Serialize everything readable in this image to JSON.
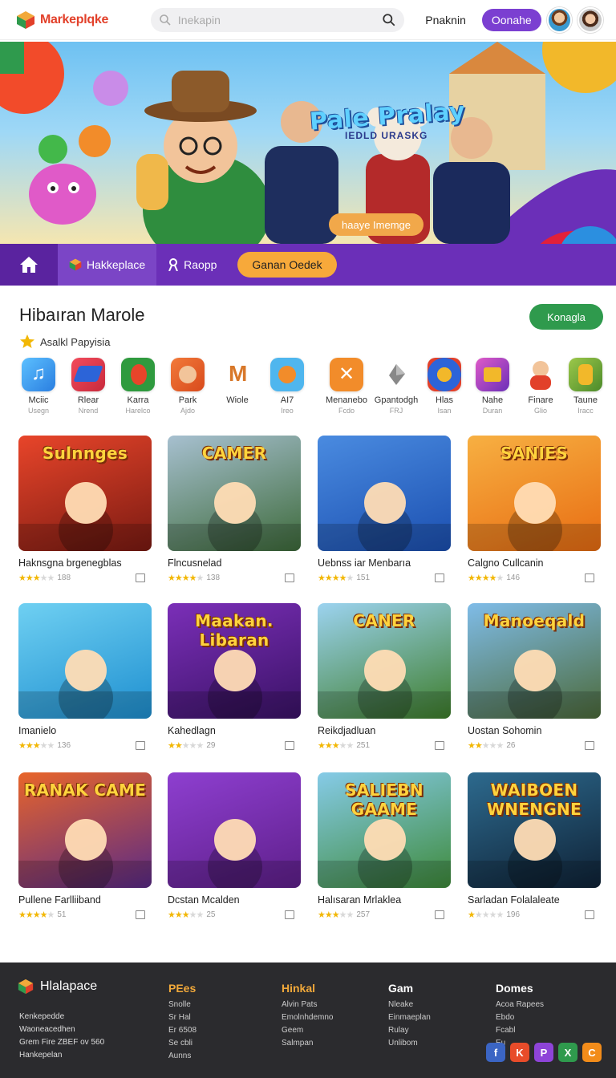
{
  "header": {
    "brand": "Markeplqke",
    "search_placeholder": "Inekapin",
    "nav_link": "Pnaknin",
    "cta": "Oonahe"
  },
  "hero": {
    "title": "Pale Pralay",
    "subtitle": "IEDLD URASKG",
    "pill": "haaye Imemge"
  },
  "catbar": {
    "items": [
      {
        "label": "Hakkeplace",
        "icon": "cube-icon"
      },
      {
        "label": "Raopp",
        "icon": "person-icon"
      }
    ],
    "pill": "Ganan Oedek"
  },
  "section": {
    "title": "Hibaıran Marole",
    "button": "Konagla",
    "subtitle": "Asalkl Papyisia"
  },
  "apps": [
    {
      "name": "Mciic",
      "sub": "Usegn",
      "color": "#3aa0f0",
      "icon": "music-note-icon"
    },
    {
      "name": "Rlear",
      "sub": "Nrend",
      "color": "#e24b5c",
      "icon": "layers-icon"
    },
    {
      "name": "Karra",
      "sub": "Harelco",
      "color": "#2f9a3e",
      "icon": "creature-icon"
    },
    {
      "name": "Park",
      "sub": "Ajdo",
      "color": "#e85a2c",
      "icon": "bear-icon"
    },
    {
      "name": "Wiole",
      "sub": "",
      "color": "#f1f1f1",
      "icon": "m-logo-icon"
    },
    {
      "name": "AI7",
      "sub": "Ireo",
      "color": "#4fb6ee",
      "icon": "fox-icon"
    },
    {
      "name": "Menanebo",
      "sub": "Fcdo",
      "color": "#f28c2a",
      "icon": "sparkle-icon"
    },
    {
      "name": "Gpantodgh",
      "sub": "FRJ",
      "color": "#f3f3f3",
      "icon": "gem-icon"
    },
    {
      "name": "Hlas",
      "sub": "Isan",
      "color": "#2c64d8",
      "icon": "swirl-icon"
    },
    {
      "name": "Nahe",
      "sub": "Duran",
      "color": "#b45fe0",
      "icon": "card-icon"
    },
    {
      "name": "Finare",
      "sub": "Glio",
      "color": "#fafafa",
      "icon": "character-icon"
    },
    {
      "name": "Taune",
      "sub": "Iracc",
      "color": "#8ab83a",
      "icon": "warrior-icon"
    }
  ],
  "cards": [
    {
      "title": "Haknsgna brgenegblas",
      "label": "Sulnnges",
      "rating": 2.5,
      "count": "188",
      "bg": "#7a1a12",
      "bg2": "#e8452a"
    },
    {
      "title": "Flncusnelad",
      "label": "CAMER",
      "rating": 3.5,
      "count": "138",
      "bg": "#3d6a3a",
      "bg2": "#a7c0d0"
    },
    {
      "title": "Uebnss iar Menbarıa",
      "label": "",
      "rating": 3.5,
      "count": "151",
      "bg": "#1b4fb0",
      "bg2": "#4a8be0"
    },
    {
      "title": "Calgno Cullcanin",
      "label": "SANIES",
      "rating": 3.5,
      "count": "146",
      "bg": "#e86c12",
      "bg2": "#f7b042"
    },
    {
      "title": "Imanielo",
      "label": "",
      "rating": 2.5,
      "count": "136",
      "bg": "#1e8fd0",
      "bg2": "#6fd0f2"
    },
    {
      "title": "Kahedlagn",
      "label": "Maakan. Libaran",
      "rating": 1.5,
      "count": "29",
      "bg": "#3a1266",
      "bg2": "#7b2fb8"
    },
    {
      "title": "Reikdjadluan",
      "label": "CANER",
      "rating": 2.5,
      "count": "251",
      "bg": "#3d7d2a",
      "bg2": "#9cd3f0"
    },
    {
      "title": "Uostan Sohomin",
      "label": "Manoeqald",
      "rating": 1.5,
      "count": "26",
      "bg": "#4c6a3a",
      "bg2": "#7fbce8"
    },
    {
      "title": "Pullene Farlliiband",
      "label": "RANAK CAME",
      "rating": 3.5,
      "count": "51",
      "bg": "#5a2a86",
      "bg2": "#e8652a"
    },
    {
      "title": "Dcstan Mcalden",
      "label": "",
      "rating": 2.5,
      "count": "25",
      "bg": "#5e1f8a",
      "bg2": "#8e3fd0"
    },
    {
      "title": "Halısaran Mrlaklea",
      "label": "SALIEBN GAAME",
      "rating": 2.5,
      "count": "257",
      "bg": "#3e8a3a",
      "bg2": "#86cbe8"
    },
    {
      "title": "Sarladan Folalaleate",
      "label": "WAIBOEN WNENGNE",
      "rating": 1,
      "count": "196",
      "bg": "#0f2236",
      "bg2": "#2d6a8e"
    }
  ],
  "footer": {
    "brand": "Hlalapace",
    "lines": [
      "Kenkepedde",
      "Waoneacedhen",
      "Grem Fire ZBEF ov 560",
      "Hankepelan"
    ],
    "cols": [
      {
        "title": "PEes",
        "color": "#f2a93a",
        "items": [
          "Snolle",
          "Sr Hal",
          "Er 6508",
          "Se cbli",
          "Aunns"
        ]
      },
      {
        "title": "Hinkal",
        "color": "#f2a93a",
        "items": [
          "Alvin Pats",
          "Emolnhdemno",
          "Geem",
          "Salmpan"
        ]
      },
      {
        "title": "Gam",
        "color": "#ffffff",
        "items": [
          "Nleake",
          "Einmaeplan",
          "Rulay",
          "Unlibom"
        ]
      },
      {
        "title": "Domes",
        "color": "#ffffff",
        "items": [
          "Acoa Rapees",
          "Ebdo",
          "Fcabl",
          "Eu"
        ]
      }
    ],
    "socials": [
      {
        "glyph": "f",
        "color": "#3b65c4",
        "icon": "facebook-icon"
      },
      {
        "glyph": "K",
        "color": "#e84c2a",
        "icon": "k-social-icon"
      },
      {
        "glyph": "P",
        "color": "#8e44d8",
        "icon": "p-social-icon"
      },
      {
        "glyph": "X",
        "color": "#2f9a4d",
        "icon": "x-social-icon"
      },
      {
        "glyph": "C",
        "color": "#f28c1a",
        "icon": "c-social-icon"
      }
    ]
  }
}
